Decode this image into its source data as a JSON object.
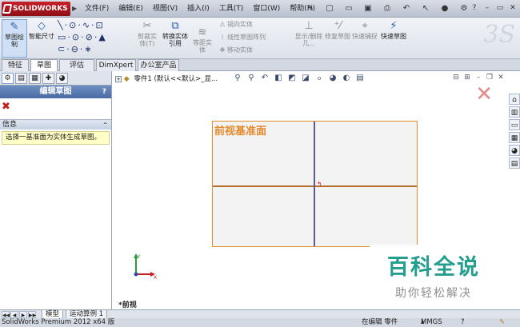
{
  "app": {
    "logo": "SOLIDWORKS"
  },
  "menu": [
    "文件(F)",
    "编辑(E)",
    "视图(V)",
    "插入(I)",
    "工具(T)",
    "窗口(W)",
    "帮助(H)"
  ],
  "ribbon": {
    "sketch": "草图绘制",
    "smart_dim": "智能尺寸",
    "trim": "剪裁实体(T)",
    "convert": "转换实体引用",
    "offset": "等距实体",
    "mirror": "镜向实体",
    "linear_pattern": "线性草图阵列",
    "move": "移动实体",
    "display_delete": "显示/删除几...",
    "repair": "修复草图",
    "quick_snaps": "快速捕捉",
    "rapid_sketch": "快速草图"
  },
  "tabs": [
    "特征",
    "草图",
    "评估",
    "DimXpert",
    "办公室产品"
  ],
  "panel": {
    "title": "编辑草图",
    "help": "?",
    "close": "✖",
    "info_title": "信息",
    "info_text": "选择一基准面为实体生成草图。"
  },
  "tree": {
    "root": "零件1 (默认<<默认>_显..."
  },
  "graphics": {
    "plane_label": "前视基准面",
    "view_name": "*前视"
  },
  "model_tabs": [
    "模型",
    "运动算例 1"
  ],
  "status": {
    "product": "SolidWorks Premium 2012 x64 版",
    "mode": "在编辑 零件",
    "units": "MMGS",
    "help": "?"
  },
  "watermark": {
    "big": "百科全说",
    "small": "助你轻松解决"
  }
}
